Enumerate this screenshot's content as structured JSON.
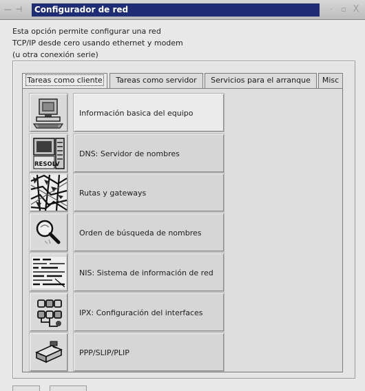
{
  "window": {
    "title": "Configurador de red",
    "menu_glyph": "— ⊣",
    "minimize_glyph": "·",
    "maximize_glyph": "▫",
    "close_glyph": "X"
  },
  "description": {
    "lines": [
      "Esta opción permite configurar una red",
      "TCP/IP desde cero usando ethernet y modem",
      "(u otra conexión serie)"
    ]
  },
  "tabs": [
    {
      "label": "Tareas como cliente",
      "active": true
    },
    {
      "label": "Tareas como servidor",
      "active": false
    },
    {
      "label": "Servicios para el arranque",
      "active": false
    },
    {
      "label": "Misc",
      "active": false
    }
  ],
  "tasks": [
    {
      "label": "Información basica del equipo",
      "icon": "computer-icon"
    },
    {
      "label": "DNS: Servidor de nombres",
      "icon": "resolv-server-icon"
    },
    {
      "label": "Rutas y gateways",
      "icon": "route-map-icon"
    },
    {
      "label": "Orden de búsqueda de nombres",
      "icon": "magnifier-icon"
    },
    {
      "label": "NIS: Sistema de información de red",
      "icon": "nis-document-icon"
    },
    {
      "label": "IPX: Configuración del interfaces",
      "icon": "ipx-network-icon"
    },
    {
      "label": "PPP/SLIP/PLIP",
      "icon": "modem-icon"
    }
  ],
  "icon_text": {
    "resolv": "RESOLV"
  },
  "colors": {
    "title_bar": "#1e2d74",
    "title_text": "#ffffff"
  }
}
